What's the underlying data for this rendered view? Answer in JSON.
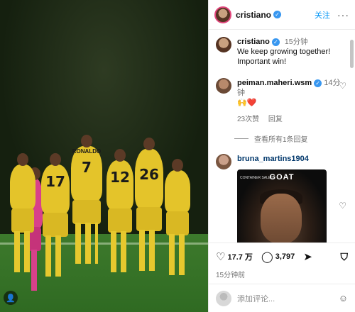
{
  "header": {
    "username": "cristiano",
    "follow_label": "关注",
    "more_icon": "more-icon"
  },
  "caption": {
    "username": "cristiano",
    "time": "15分钟",
    "text_line1": "We keep growing together!",
    "text_line2": "Important win!"
  },
  "comments": [
    {
      "username": "peiman.maheri.wsm",
      "time": "14分钟",
      "text": "🙌❤️",
      "likes": "23次赞",
      "reply_label": "回复",
      "view_replies": "查看所有1条回复"
    },
    {
      "username": "bruna_martins1904",
      "image_top_text": "GOAT",
      "image_small_text": "CONTAINER SALEH"
    }
  ],
  "actions": {
    "likes_count": "17.7 万",
    "comments_count": "3,797"
  },
  "post_time": "15分钟前",
  "add_comment": {
    "placeholder": "添加评论..."
  },
  "colors": {
    "accent": "#0095f6",
    "verified": "#3897f0",
    "jersey": "#e4c42a"
  }
}
